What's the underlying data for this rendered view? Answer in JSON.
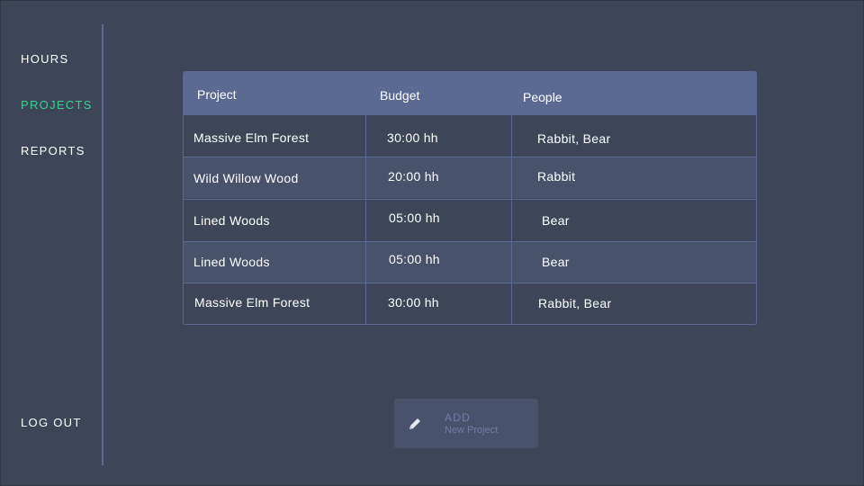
{
  "nav": {
    "hours": "HOURS",
    "projects": "PROJECTS",
    "reports": "REPORTS",
    "logout": "LOG OUT"
  },
  "colors": {
    "background": "#3d4659",
    "header": "#5b6a93",
    "active_nav": "#3ecf8e",
    "alt_row": "#47526b",
    "muted_text": "#6f7ea7"
  },
  "table": {
    "headers": {
      "project": "Project",
      "budget": "Budget",
      "people": "People"
    },
    "rows": [
      {
        "project": "Massive Elm Forest",
        "budget": "30:00 hh",
        "people": "Rabbit, Bear"
      },
      {
        "project": "Wild Willow Wood",
        "budget": "20:00 hh",
        "people": "Rabbit"
      },
      {
        "project": "Lined Woods",
        "budget": "05:00 hh",
        "people": "Bear"
      },
      {
        "project": "Lined Woods",
        "budget": "05:00 hh",
        "people": "Bear"
      },
      {
        "project": "Massive Elm Forest",
        "budget": "30:00 hh",
        "people": "Rabbit, Bear"
      }
    ]
  },
  "add_button": {
    "title": "ADD",
    "subtitle": "New Project",
    "icon": "pencil-icon"
  }
}
